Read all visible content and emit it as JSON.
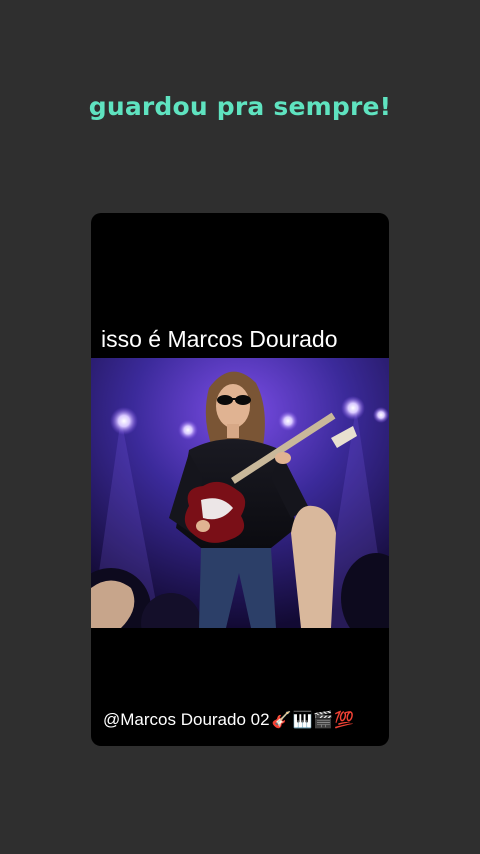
{
  "story": {
    "caption": "guardou pra sempre!",
    "video": {
      "overlay_text": "isso é Marcos Dourado",
      "handle": "@Marcos Dourado 02",
      "handle_emojis": "🎸🎹🎬💯",
      "emoji_icons": [
        "guitar-icon",
        "piano-keys-icon",
        "clapper-board-icon",
        "hundred-points-icon"
      ]
    }
  },
  "colors": {
    "background": "#2f2f2f",
    "caption": "#5fe3c0",
    "card": "#000000",
    "stage_light": "#6b3bd6"
  }
}
